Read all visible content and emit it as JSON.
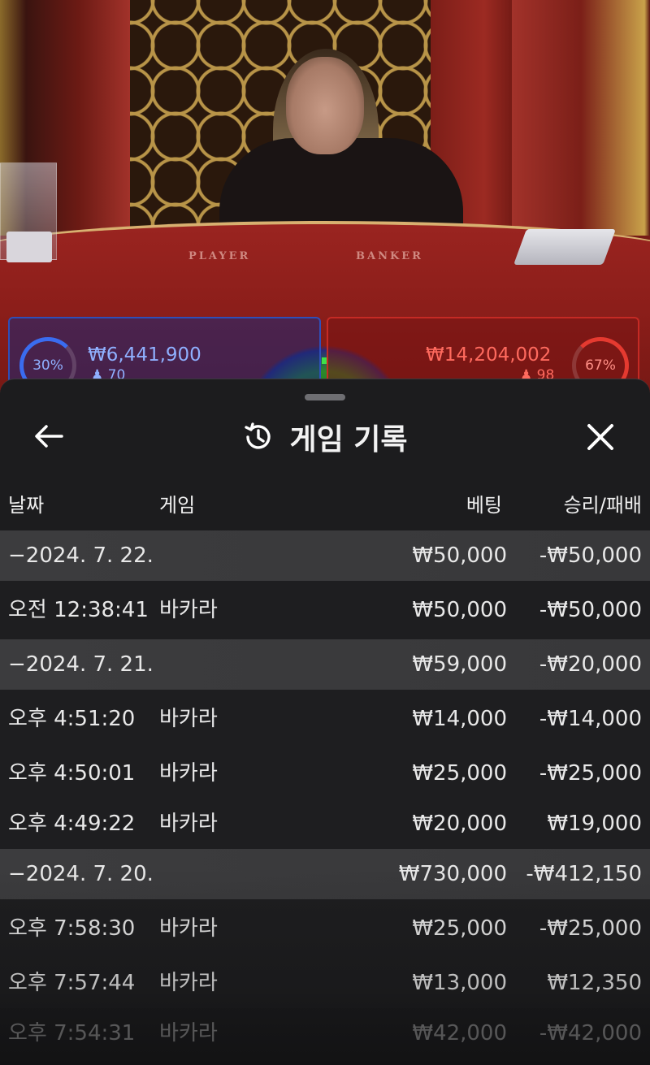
{
  "background": {
    "table_labels": {
      "player": "PLAYER",
      "banker": "BANKER"
    },
    "player_side": {
      "percent": "30%",
      "amount": "₩6,441,900",
      "count": "70",
      "color": "#3a6cf0"
    },
    "banker_side": {
      "percent": "67%",
      "amount": "₩14,204,002",
      "count": "98",
      "color": "#e53a30"
    }
  },
  "sheet": {
    "title": "게임 기록",
    "icons": {
      "back": "arrow-left-icon",
      "history": "history-icon",
      "close": "close-icon"
    },
    "columns": {
      "date": "날짜",
      "game": "게임",
      "bet": "베팅",
      "result": "승리/패배"
    },
    "groups": [
      {
        "date": "−2024. 7. 22.",
        "bet": "₩50,000",
        "result": "-₩50,000",
        "rows": [
          {
            "time": "오전 12:38:41",
            "game": "바카라",
            "bet": "₩50,000",
            "result": "-₩50,000"
          }
        ]
      },
      {
        "date": "−2024. 7. 21.",
        "bet": "₩59,000",
        "result": "-₩20,000",
        "rows": [
          {
            "time": "오후 4:51:20",
            "game": "바카라",
            "bet": "₩14,000",
            "result": "-₩14,000"
          },
          {
            "time": "오후 4:50:01",
            "game": "바카라",
            "bet": "₩25,000",
            "result": "-₩25,000"
          },
          {
            "time": "오후 4:49:22",
            "game": "바카라",
            "bet": "₩20,000",
            "result": "₩19,000"
          }
        ]
      },
      {
        "date": "−2024. 7. 20.",
        "bet": "₩730,000",
        "result": "-₩412,150",
        "rows": [
          {
            "time": "오후 7:58:30",
            "game": "바카라",
            "bet": "₩25,000",
            "result": "-₩25,000"
          },
          {
            "time": "오후 7:57:44",
            "game": "바카라",
            "bet": "₩13,000",
            "result": "₩12,350"
          },
          {
            "time": "오후 7:54:31",
            "game": "바카라",
            "bet": "₩42,000",
            "result": "-₩42,000"
          }
        ]
      }
    ]
  }
}
